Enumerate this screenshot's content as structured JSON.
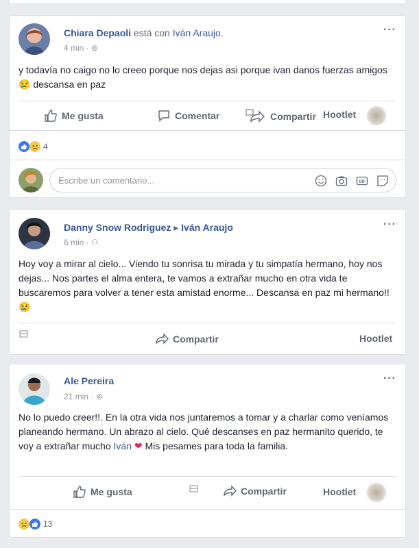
{
  "posts": [
    {
      "author": "Chiara Depaoli",
      "with_text": "está con",
      "with_name": "Iván Araujo.",
      "time": "4 min",
      "more": "···",
      "text": "y todavía no caigo no lo creeo porque nos dejas asi porque ivan danos fuerzas amigos",
      "text_end": "descansa en paz",
      "actions": {
        "like": "Me gusta",
        "comment": "Comentar",
        "share": "Compartir",
        "hootlet": "Hootlet"
      },
      "reaction_count": "4",
      "comment_placeholder": "Escribe un comentario..."
    },
    {
      "author": "Danny Snow Rodriguez",
      "target": "Iván Araujo",
      "time": "6 min",
      "more": "···",
      "text": "Hoy voy a mirar al cielo... Viendo tu sonrisa tu mirada y tu simpatía hermano, hoy nos dejas... Nos partes el alma entera, te vamos a extrañar mucho en otra vida te buscaremos para volver a tener esta amistad enorme... Descansa en paz mi hermano!!",
      "actions": {
        "share": "Compartir",
        "hootlet": "Hootlet"
      }
    },
    {
      "author": "Ale Pereira",
      "time": "21 min",
      "more": "···",
      "text": "No lo puedo creer!!. En la otra vida nos juntaremos a tomar y a charlar como veníamos planeando hermano. Un abrazo al cielo. Qué descanses en paz hermanito querido, te voy a extrañar mucho",
      "mention": "Iván",
      "text_end": "Mis pesames para toda la familia.",
      "actions": {
        "like": "Me gusta",
        "share": "Compartir",
        "hootlet": "Hootlet"
      },
      "reaction_count": "13"
    }
  ],
  "colors": {
    "link": "#365899",
    "like": "#3b78e7",
    "heart": "#e0245e",
    "sad": "#f2c94c"
  }
}
